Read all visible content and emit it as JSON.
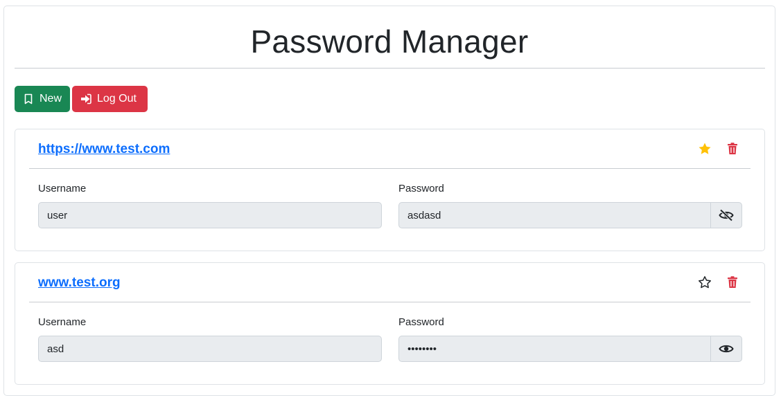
{
  "app": {
    "title": "Password Manager"
  },
  "toolbar": {
    "new_label": "New",
    "logout_label": "Log Out"
  },
  "colors": {
    "success": "#198754",
    "danger": "#dc3545",
    "link": "#0d6efd",
    "star_active": "#ffc107"
  },
  "entries": [
    {
      "url": "https://www.test.com",
      "username_label": "Username",
      "username": "user",
      "password_label": "Password",
      "password_display": "asdasd",
      "favorite": true,
      "password_visible": true,
      "visibility_icon": "eye-slash-icon"
    },
    {
      "url": "www.test.org",
      "username_label": "Username",
      "username": "asd",
      "password_label": "Password",
      "password_display": "••••••••",
      "favorite": false,
      "password_visible": false,
      "visibility_icon": "eye-icon"
    }
  ]
}
